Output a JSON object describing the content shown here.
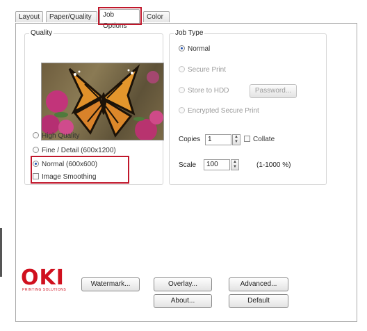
{
  "tabs": [
    {
      "label": "Layout"
    },
    {
      "label": "Paper/Quality"
    },
    {
      "label": "Job Options"
    },
    {
      "label": "Color"
    }
  ],
  "quality": {
    "legend": "Quality",
    "photo_name": "monarch-butterfly-photo",
    "options": [
      {
        "label": "High Quality",
        "selected": false
      },
      {
        "label": "Fine / Detail (600x1200)",
        "selected": false
      },
      {
        "label": "Normal (600x600)",
        "selected": true
      }
    ],
    "image_smoothing": {
      "label": "Image Smoothing",
      "checked": false
    }
  },
  "job_type": {
    "legend": "Job Type",
    "options": [
      {
        "label": "Normal",
        "selected": true,
        "enabled": true
      },
      {
        "label": "Secure Print",
        "selected": false,
        "enabled": false
      },
      {
        "label": "Store to HDD",
        "selected": false,
        "enabled": false
      },
      {
        "label": "Encrypted Secure Print",
        "selected": false,
        "enabled": false
      }
    ],
    "password_button": "Password..."
  },
  "copies": {
    "label": "Copies",
    "value": "1",
    "collate_label": "Collate"
  },
  "scale": {
    "label": "Scale",
    "value": "100",
    "range": "(1-1000 %)"
  },
  "buttons": {
    "watermark": "Watermark...",
    "overlay": "Overlay...",
    "advanced": "Advanced...",
    "about": "About...",
    "default": "Default"
  },
  "brand": {
    "logo": "OKI",
    "tagline": "PRINTING SOLUTIONS",
    "color": "#d0101e"
  },
  "highlight_color": "#c0172b"
}
